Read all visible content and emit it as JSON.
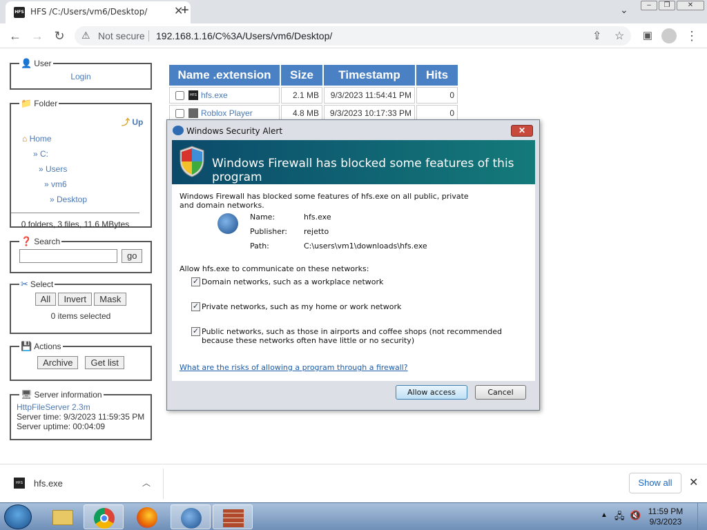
{
  "browser": {
    "tab_title": "HFS /C:/Users/vm6/Desktop/",
    "tab_favicon_text": "HFS",
    "security_label": "Not secure",
    "url": "192.168.1.16/C%3A/Users/vm6/Desktop/"
  },
  "user_panel": {
    "legend": "User",
    "login": "Login"
  },
  "folder_panel": {
    "legend": "Folder",
    "up": "Up",
    "home": "Home",
    "path": [
      "» C:",
      "» Users",
      "» vm6",
      "» Desktop"
    ],
    "summary": "0 folders, 3 files, 11.6 MBytes"
  },
  "search_panel": {
    "legend": "Search",
    "go": "go",
    "value": ""
  },
  "select_panel": {
    "legend": "Select",
    "all": "All",
    "invert": "Invert",
    "mask": "Mask",
    "status": "0 items selected"
  },
  "actions_panel": {
    "legend": "Actions",
    "archive": "Archive",
    "getlist": "Get list"
  },
  "server_panel": {
    "legend": "Server information",
    "software": "HttpFileServer 2.3m",
    "time": "Server time: 9/3/2023 11:59:35 PM",
    "uptime": "Server uptime: 00:04:09"
  },
  "file_table": {
    "headers": [
      "Name .extension",
      "Size",
      "Timestamp",
      "Hits"
    ],
    "rows": [
      {
        "name": "hfs.exe",
        "size": "2.1 MB",
        "timestamp": "9/3/2023 11:54:41 PM",
        "hits": "0"
      },
      {
        "name": "Roblox Player",
        "size": "4.8 MB",
        "timestamp": "9/3/2023 10:17:33 PM",
        "hits": "0"
      }
    ]
  },
  "dialog": {
    "title": "Windows Security Alert",
    "banner": "Windows Firewall has blocked some features of this program",
    "intro": "Windows Firewall has blocked some features of hfs.exe on all public, private and domain networks.",
    "name_label": "Name:",
    "name_value": "hfs.exe",
    "publisher_label": "Publisher:",
    "publisher_value": "rejetto",
    "path_label": "Path:",
    "path_value": "C:\\users\\vm1\\downloads\\hfs.exe",
    "allow_heading": "Allow hfs.exe to communicate on these networks:",
    "opt_domain": "Domain networks, such as a workplace network",
    "opt_private": "Private networks, such as my home or work network",
    "opt_public_1": "Public networks, such as those in airports and coffee shops (not recommended",
    "opt_public_2": "because these networks often have little or no security)",
    "link": "What are the risks of allowing a program through a firewall?",
    "allow_btn": "Allow access",
    "cancel_btn": "Cancel"
  },
  "download_bar": {
    "file": "hfs.exe",
    "show_all": "Show all"
  },
  "taskbar": {
    "time": "11:59 PM",
    "date": "9/3/2023"
  },
  "colors": {
    "accent": "#4a81c4",
    "banner": "#0b4a6a",
    "link": "#1a5aa8"
  }
}
